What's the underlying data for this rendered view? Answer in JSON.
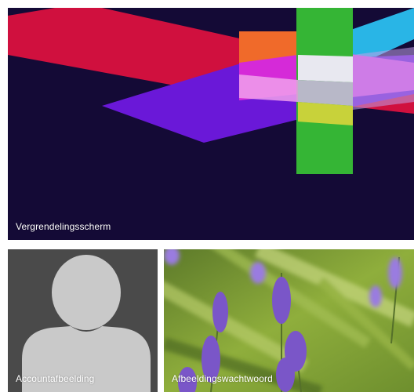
{
  "tiles": {
    "lock_screen": {
      "label": "Vergrendelingsscherm"
    },
    "account_picture": {
      "label": "Accountafbeelding"
    },
    "picture_password": {
      "label": "Afbeeldingswachtwoord"
    }
  },
  "icons": {
    "lock_screen": "abstract-shapes-image",
    "account_picture": "user-silhouette-icon",
    "picture_password": "lavender-photo"
  },
  "colors": {
    "lock_background": "#140a36",
    "account_background": "#4a4a4a",
    "silhouette": "#c9c9c9"
  }
}
